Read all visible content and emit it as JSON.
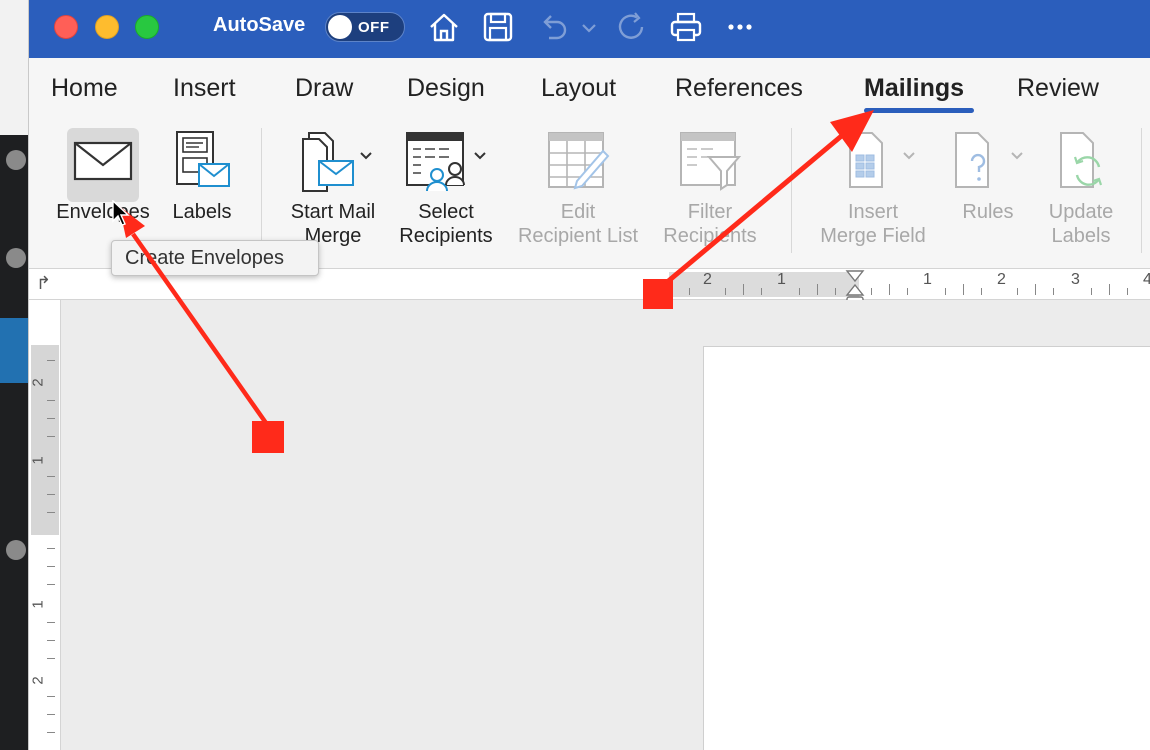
{
  "titlebar": {
    "autosave_label": "AutoSave",
    "autosave_state": "OFF",
    "icons": [
      "home-icon",
      "save-icon",
      "undo-icon",
      "dropdown-chevron-icon",
      "redo-icon",
      "print-icon",
      "more-icon"
    ]
  },
  "tabs": [
    "Home",
    "Insert",
    "Draw",
    "Design",
    "Layout",
    "References",
    "Mailings",
    "Review"
  ],
  "active_tab": "Mailings",
  "ribbon": {
    "envelopes": "Envelopes",
    "labels": "Labels",
    "start_mail_merge_1": "Start Mail",
    "start_mail_merge_2": "Merge",
    "select_recipients_1": "Select",
    "select_recipients_2": "Recipients",
    "edit_recipient_list_1": "Edit",
    "edit_recipient_list_2": "Recipient List",
    "filter_recipients_1": "Filter",
    "filter_recipients_2": "Recipients",
    "insert_merge_field_1": "Insert",
    "insert_merge_field_2": "Merge Field",
    "rules": "Rules",
    "update_labels_1": "Update",
    "update_labels_2": "Labels"
  },
  "tooltip": "Create Envelopes",
  "ruler": {
    "h_numbers": [
      "2",
      "1",
      "1",
      "2",
      "3",
      "4"
    ],
    "v_numbers": [
      "2",
      "1",
      "1",
      "2"
    ]
  },
  "colors": {
    "titlebar": "#2b5ebc",
    "annotation": "#ff2a1a",
    "accent": "#2b5ebc"
  }
}
